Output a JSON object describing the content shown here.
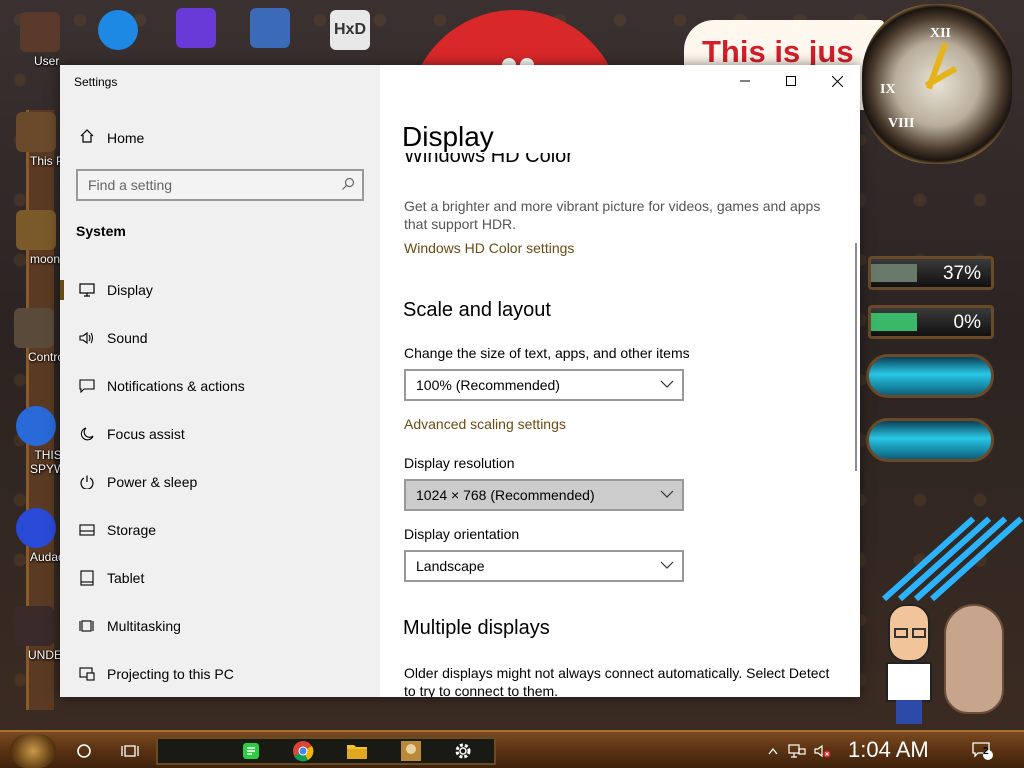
{
  "desktop": {
    "icons": [
      {
        "label": "User",
        "color": "#5a3a2a"
      },
      {
        "label": "This P",
        "color": "#6a4a2a"
      },
      {
        "label": "moon gi",
        "color": "#7a5a2a"
      },
      {
        "label": "Control P",
        "color": "#5a4a3a"
      },
      {
        "label": "THIS I SPYWA",
        "color": "#2a6ad8"
      },
      {
        "label": "Audaci",
        "color": "#2a4ad8"
      },
      {
        "label": "UNDE",
        "color": "#3a2a2a"
      }
    ],
    "top_icons": [
      {
        "label": "",
        "color": "#1e88e5"
      },
      {
        "label": "",
        "color": "#6a3ad8"
      },
      {
        "label": "",
        "color": "#3a6ab8"
      },
      {
        "label": "",
        "color": "#e8e8e8"
      }
    ],
    "banner_text": "This is jus",
    "gauges": [
      {
        "value": "37%",
        "fraction": 0.37,
        "color": "#6a7a6a"
      },
      {
        "value": "0%",
        "fraction": 0.0,
        "color": "#3ab86a"
      }
    ]
  },
  "window": {
    "title": "Settings",
    "controls": {
      "minimize": "—",
      "maximize": "☐",
      "close": "✕"
    },
    "nav": {
      "home": "Home",
      "search_placeholder": "Find a setting",
      "section": "System",
      "items": [
        {
          "label": "Display",
          "icon": "monitor-icon",
          "selected": true
        },
        {
          "label": "Sound",
          "icon": "speaker-icon",
          "selected": false
        },
        {
          "label": "Notifications & actions",
          "icon": "notification-icon",
          "selected": false
        },
        {
          "label": "Focus assist",
          "icon": "moon-icon",
          "selected": false
        },
        {
          "label": "Power & sleep",
          "icon": "power-icon",
          "selected": false
        },
        {
          "label": "Storage",
          "icon": "storage-icon",
          "selected": false
        },
        {
          "label": "Tablet",
          "icon": "tablet-icon",
          "selected": false
        },
        {
          "label": "Multitasking",
          "icon": "multitasking-icon",
          "selected": false
        },
        {
          "label": "Projecting to this PC",
          "icon": "projecting-icon",
          "selected": false
        }
      ],
      "accent": "#6b4a14"
    },
    "content": {
      "title": "Display",
      "hd_color_heading": "Windows HD Color",
      "hd_color_desc": "Get a brighter and more vibrant picture for videos, games and apps that support HDR.",
      "hd_color_link": "Windows HD Color settings",
      "scale_heading": "Scale and layout",
      "scale_label": "Change the size of text, apps, and other items",
      "scale_value": "100% (Recommended)",
      "advanced_link": "Advanced scaling settings",
      "resolution_label": "Display resolution",
      "resolution_value": "1024 × 768 (Recommended)",
      "orientation_label": "Display orientation",
      "orientation_value": "Landscape",
      "multi_heading": "Multiple displays",
      "multi_desc": "Older displays might not always connect automatically. Select Detect to try to connect to them."
    }
  },
  "taskbar": {
    "time": "1:04 AM",
    "notification_count": "2"
  }
}
